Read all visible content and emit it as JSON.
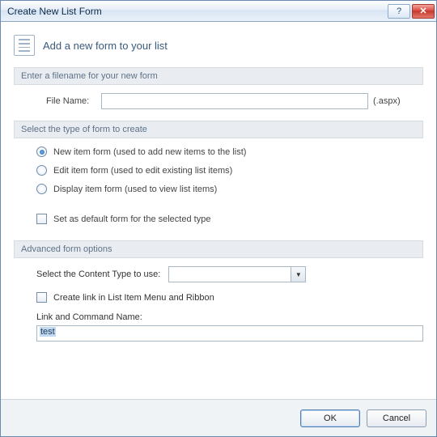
{
  "window": {
    "title": "Create New List Form",
    "help_tooltip": "Help",
    "close_tooltip": "Close"
  },
  "header": {
    "title": "Add a new form to your list"
  },
  "filename_section": {
    "heading": "Enter a filename for your new form",
    "label": "File Name:",
    "value": "",
    "suffix": "(.aspx)"
  },
  "form_type_section": {
    "heading": "Select the type of form to create",
    "options": [
      {
        "label": "New item form (used to add new items to the list)",
        "selected": true
      },
      {
        "label": "Edit item form (used to edit existing list items)",
        "selected": false
      },
      {
        "label": "Display item form (used to view list items)",
        "selected": false
      }
    ],
    "default_checkbox": {
      "label": "Set as default form for the selected type",
      "checked": false
    }
  },
  "advanced_section": {
    "heading": "Advanced form options",
    "content_type_label": "Select the Content Type to use:",
    "content_type_value": "",
    "create_link_checkbox": {
      "label": "Create link in List Item Menu and Ribbon",
      "checked": false
    },
    "link_name_label": "Link and Command Name:",
    "link_name_value": "test"
  },
  "footer": {
    "ok": "OK",
    "cancel": "Cancel"
  }
}
